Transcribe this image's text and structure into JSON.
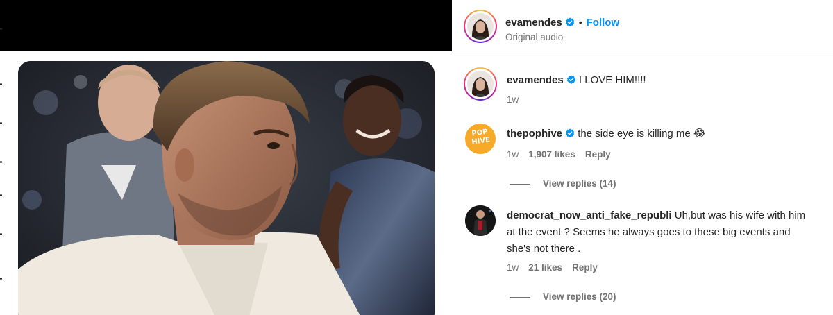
{
  "post": {
    "author": "evamendes",
    "follow_label": "Follow",
    "separator": "•",
    "audio": "Original audio"
  },
  "caption": {
    "author": "evamendes",
    "text": "I LOVE HIM!!!!",
    "time": "1w"
  },
  "comments": [
    {
      "author": "thepophive",
      "verified": true,
      "text": "the side eye is killing me 😂",
      "avatar_text": [
        "POP",
        "HIVE"
      ],
      "time": "1w",
      "likes": "1,907 likes",
      "reply": "Reply",
      "view_replies": "View replies (14)"
    },
    {
      "author": "democrat_now_anti_fake_republi",
      "verified": false,
      "text_lines": [
        "Uh,but was his wife with him",
        "at the event ? Seems he always goes to these big events and",
        "she's not there ."
      ],
      "time": "1w",
      "likes": "21 likes",
      "reply": "Reply",
      "view_replies": "View replies (20)"
    }
  ],
  "colors": {
    "link_blue": "#0095f6",
    "verified_blue": "#0095f6",
    "pophive_orange": "#f7a928",
    "muted": "#737373"
  },
  "icons": {
    "verified": "verified-badge-icon"
  }
}
